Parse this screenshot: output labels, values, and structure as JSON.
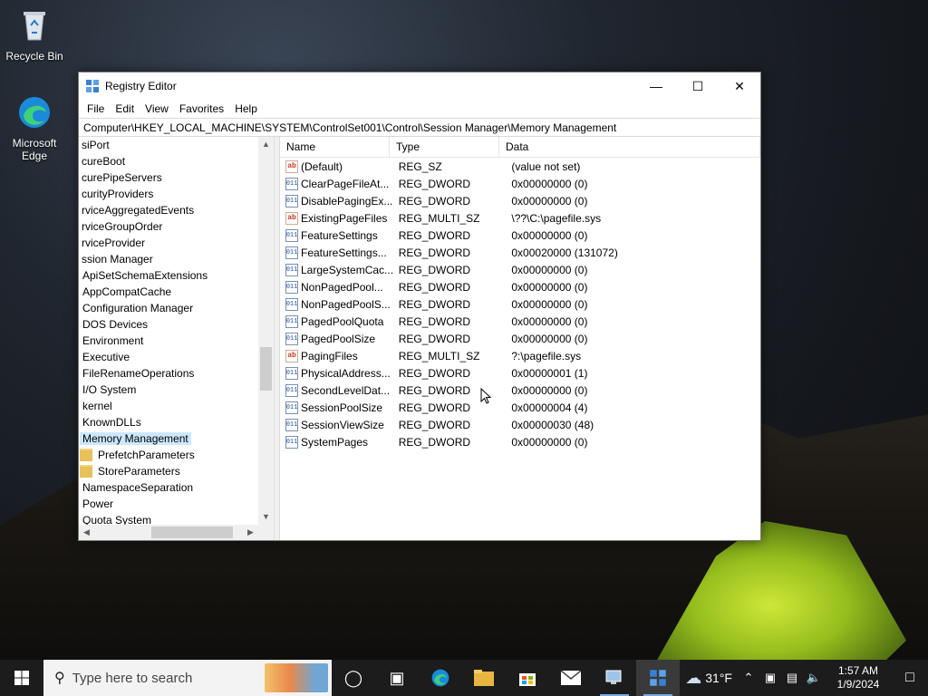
{
  "desktop": {
    "icons": [
      {
        "label": "Recycle Bin"
      },
      {
        "label": "Microsoft Edge"
      }
    ]
  },
  "window": {
    "title": "Registry Editor",
    "menu": [
      "File",
      "Edit",
      "View",
      "Favorites",
      "Help"
    ],
    "address": "Computer\\HKEY_LOCAL_MACHINE\\SYSTEM\\ControlSet001\\Control\\Session Manager\\Memory Management",
    "tree": [
      {
        "label": "siPort",
        "level": 0
      },
      {
        "label": "cureBoot",
        "level": 0
      },
      {
        "label": "curePipeServers",
        "level": 0
      },
      {
        "label": "curityProviders",
        "level": 0
      },
      {
        "label": "rviceAggregatedEvents",
        "level": 0
      },
      {
        "label": "rviceGroupOrder",
        "level": 0
      },
      {
        "label": "rviceProvider",
        "level": 0
      },
      {
        "label": "ssion Manager",
        "level": 0
      },
      {
        "label": "ApiSetSchemaExtensions",
        "level": 1
      },
      {
        "label": "AppCompatCache",
        "level": 1
      },
      {
        "label": "Configuration Manager",
        "level": 1
      },
      {
        "label": "DOS Devices",
        "level": 1
      },
      {
        "label": "Environment",
        "level": 1
      },
      {
        "label": "Executive",
        "level": 1
      },
      {
        "label": "FileRenameOperations",
        "level": 1
      },
      {
        "label": "I/O System",
        "level": 1
      },
      {
        "label": "kernel",
        "level": 1
      },
      {
        "label": "KnownDLLs",
        "level": 1
      },
      {
        "label": "Memory Management",
        "level": 1,
        "selected": true
      },
      {
        "label": "PrefetchParameters",
        "level": 2
      },
      {
        "label": "StoreParameters",
        "level": 2
      },
      {
        "label": "NamespaceSeparation",
        "level": 1
      },
      {
        "label": "Power",
        "level": 1
      },
      {
        "label": "Quota System",
        "level": 1
      }
    ],
    "columns": {
      "name": "Name",
      "type": "Type",
      "data": "Data"
    },
    "values": [
      {
        "icon": "string",
        "name": "(Default)",
        "type": "REG_SZ",
        "data": "(value not set)"
      },
      {
        "icon": "binary",
        "name": "ClearPageFileAt...",
        "type": "REG_DWORD",
        "data": "0x00000000 (0)"
      },
      {
        "icon": "binary",
        "name": "DisablePagingEx...",
        "type": "REG_DWORD",
        "data": "0x00000000 (0)"
      },
      {
        "icon": "string",
        "name": "ExistingPageFiles",
        "type": "REG_MULTI_SZ",
        "data": "\\??\\C:\\pagefile.sys"
      },
      {
        "icon": "binary",
        "name": "FeatureSettings",
        "type": "REG_DWORD",
        "data": "0x00000000 (0)"
      },
      {
        "icon": "binary",
        "name": "FeatureSettings...",
        "type": "REG_DWORD",
        "data": "0x00020000 (131072)"
      },
      {
        "icon": "binary",
        "name": "LargeSystemCac...",
        "type": "REG_DWORD",
        "data": "0x00000000 (0)"
      },
      {
        "icon": "binary",
        "name": "NonPagedPool...",
        "type": "REG_DWORD",
        "data": "0x00000000 (0)"
      },
      {
        "icon": "binary",
        "name": "NonPagedPoolS...",
        "type": "REG_DWORD",
        "data": "0x00000000 (0)"
      },
      {
        "icon": "binary",
        "name": "PagedPoolQuota",
        "type": "REG_DWORD",
        "data": "0x00000000 (0)"
      },
      {
        "icon": "binary",
        "name": "PagedPoolSize",
        "type": "REG_DWORD",
        "data": "0x00000000 (0)"
      },
      {
        "icon": "string",
        "name": "PagingFiles",
        "type": "REG_MULTI_SZ",
        "data": "?:\\pagefile.sys"
      },
      {
        "icon": "binary",
        "name": "PhysicalAddress...",
        "type": "REG_DWORD",
        "data": "0x00000001 (1)"
      },
      {
        "icon": "binary",
        "name": "SecondLevelDat...",
        "type": "REG_DWORD",
        "data": "0x00000000 (0)"
      },
      {
        "icon": "binary",
        "name": "SessionPoolSize",
        "type": "REG_DWORD",
        "data": "0x00000004 (4)"
      },
      {
        "icon": "binary",
        "name": "SessionViewSize",
        "type": "REG_DWORD",
        "data": "0x00000030 (48)"
      },
      {
        "icon": "binary",
        "name": "SystemPages",
        "type": "REG_DWORD",
        "data": "0x00000000 (0)"
      }
    ]
  },
  "taskbar": {
    "search_placeholder": "Type here to search",
    "weather": "31°F",
    "time": "1:57 AM",
    "date": "1/9/2024"
  }
}
